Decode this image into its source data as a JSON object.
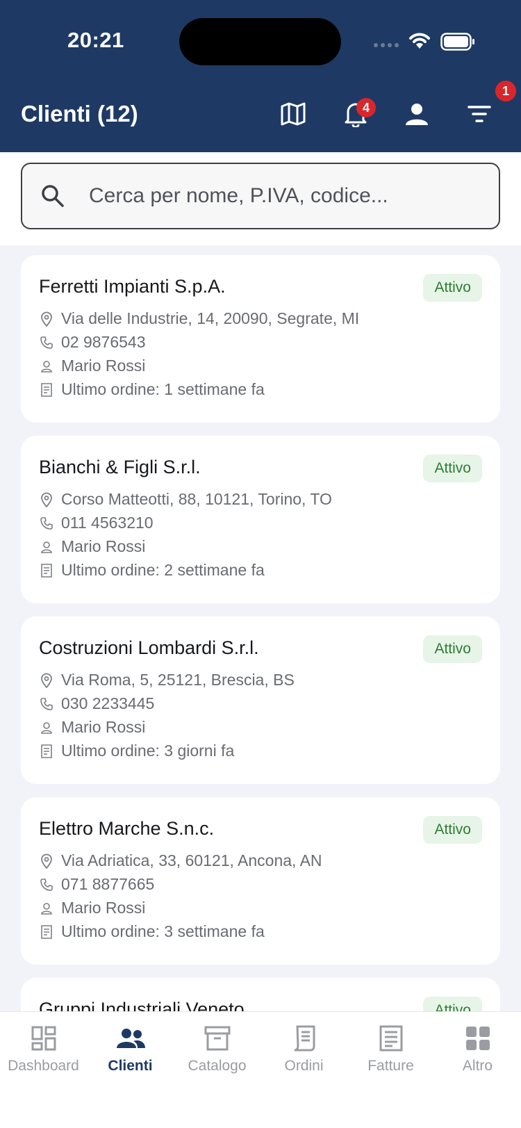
{
  "status_bar": {
    "time": "20:21"
  },
  "header": {
    "title": "Clienti (12)",
    "notification_count": "4",
    "filter_count": "1"
  },
  "search": {
    "placeholder": "Cerca per nome, P.IVA, codice..."
  },
  "clients": [
    {
      "name": "Ferretti Impianti S.p.A.",
      "status": "Attivo",
      "address": "Via delle Industrie, 14, 20090, Segrate, MI",
      "phone": "02 9876543",
      "agent": "Mario Rossi",
      "last_order": "Ultimo ordine: 1 settimane fa"
    },
    {
      "name": "Bianchi & Figli S.r.l.",
      "status": "Attivo",
      "address": "Corso Matteotti, 88, 10121, Torino, TO",
      "phone": "011 4563210",
      "agent": "Mario Rossi",
      "last_order": "Ultimo ordine: 2 settimane fa"
    },
    {
      "name": "Costruzioni Lombardi S.r.l.",
      "status": "Attivo",
      "address": "Via Roma, 5, 25121, Brescia, BS",
      "phone": "030 2233445",
      "agent": "Mario Rossi",
      "last_order": "Ultimo ordine: 3 giorni fa"
    },
    {
      "name": "Elettro Marche S.n.c.",
      "status": "Attivo",
      "address": "Via Adriatica, 33, 60121, Ancona, AN",
      "phone": "071 8877665",
      "agent": "Mario Rossi",
      "last_order": "Ultimo ordine: 3 settimane fa"
    },
    {
      "name": "Gruppi Industriali Veneto",
      "status": "Attivo",
      "address": "",
      "phone": "",
      "agent": "",
      "last_order": ""
    }
  ],
  "tabs": [
    {
      "label": "Dashboard",
      "icon": "dashboard-icon"
    },
    {
      "label": "Clienti",
      "icon": "people-icon"
    },
    {
      "label": "Catalogo",
      "icon": "archive-box-icon"
    },
    {
      "label": "Ordini",
      "icon": "receipt-icon"
    },
    {
      "label": "Fatture",
      "icon": "invoice-icon"
    },
    {
      "label": "Altro",
      "icon": "grid-icon"
    }
  ],
  "colors": {
    "header": "#1e3a64",
    "badge": "#d8262c",
    "status_active_bg": "#e7f4e8",
    "status_active_text": "#2e7d32"
  }
}
